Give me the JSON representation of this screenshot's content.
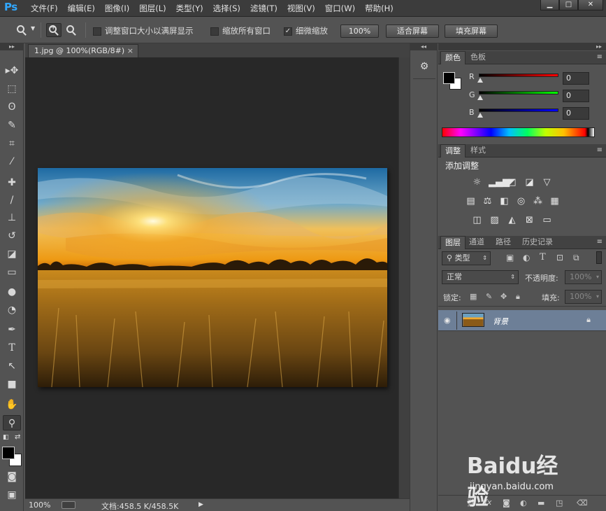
{
  "app": {
    "logo": "Ps",
    "menus": [
      "文件(F)",
      "编辑(E)",
      "图像(I)",
      "图层(L)",
      "类型(Y)",
      "选择(S)",
      "滤镜(T)",
      "视图(V)",
      "窗口(W)",
      "帮助(H)"
    ],
    "window_buttons": {
      "minimize": "▁",
      "restore": "□",
      "close": "✕"
    }
  },
  "options": {
    "resize_windows_label": "调整窗口大小以满屏显示",
    "resize_windows_checked": false,
    "zoom_all_label": "缩放所有窗口",
    "zoom_all_checked": false,
    "scrubby_zoom_label": "细微缩放",
    "scrubby_zoom_checked": true,
    "btn_100": "100%",
    "btn_fit": "适合屏幕",
    "btn_fill": "填充屏幕"
  },
  "document": {
    "tab_title": "1.jpg @ 100%(RGB/8#)",
    "tab_close": "×",
    "zoom": "100%",
    "doc_info": "文档:458.5 K/458.5K",
    "status_arrow": "▶"
  },
  "color_panel": {
    "tabs": [
      "颜色",
      "色板"
    ],
    "channels": [
      {
        "label": "R",
        "value": "0",
        "color": "#ff0000"
      },
      {
        "label": "G",
        "value": "0",
        "color": "#00ff00"
      },
      {
        "label": "B",
        "value": "0",
        "color": "#0000ff"
      }
    ],
    "foreground": "#000000",
    "background": "#ffffff"
  },
  "adjust_panel": {
    "tabs": [
      "调整",
      "样式"
    ],
    "heading": "添加调整"
  },
  "layers_panel": {
    "tabs": [
      "图层",
      "通道",
      "路径",
      "历史记录"
    ],
    "filter_kind": "类型",
    "blend_mode": "正常",
    "opacity_label": "不透明度:",
    "opacity_value": "100%",
    "lock_label": "锁定:",
    "fill_label": "填充:",
    "fill_value": "100%",
    "layers": [
      {
        "name": "背景",
        "visible": true,
        "locked": true
      }
    ],
    "footer_icons": [
      "link-icon",
      "fx-icon",
      "mask-icon",
      "adjustment-icon",
      "group-icon",
      "new-layer-icon",
      "trash-icon"
    ],
    "fx_label": "fx"
  },
  "watermark": {
    "brand": "Baidu经验",
    "url": "jingyan.baidu.com"
  },
  "tool_glyphs": {
    "move": "▸✥",
    "marquee": "⬚",
    "lasso": "ʘ",
    "quick_select": "✎",
    "crop": "⌗",
    "eyedropper": "⁄",
    "healing": "✚",
    "brush": "/",
    "stamp": "⊥",
    "history_brush": "↺",
    "eraser": "◪",
    "gradient": "▭",
    "blur": "●",
    "dodge": "◔",
    "pen": "✒",
    "type": "T",
    "path_select": "↖",
    "shape": "■",
    "hand": "✋",
    "zoom": "⚲",
    "quickmask": "◙",
    "screen_mode": "▣"
  }
}
